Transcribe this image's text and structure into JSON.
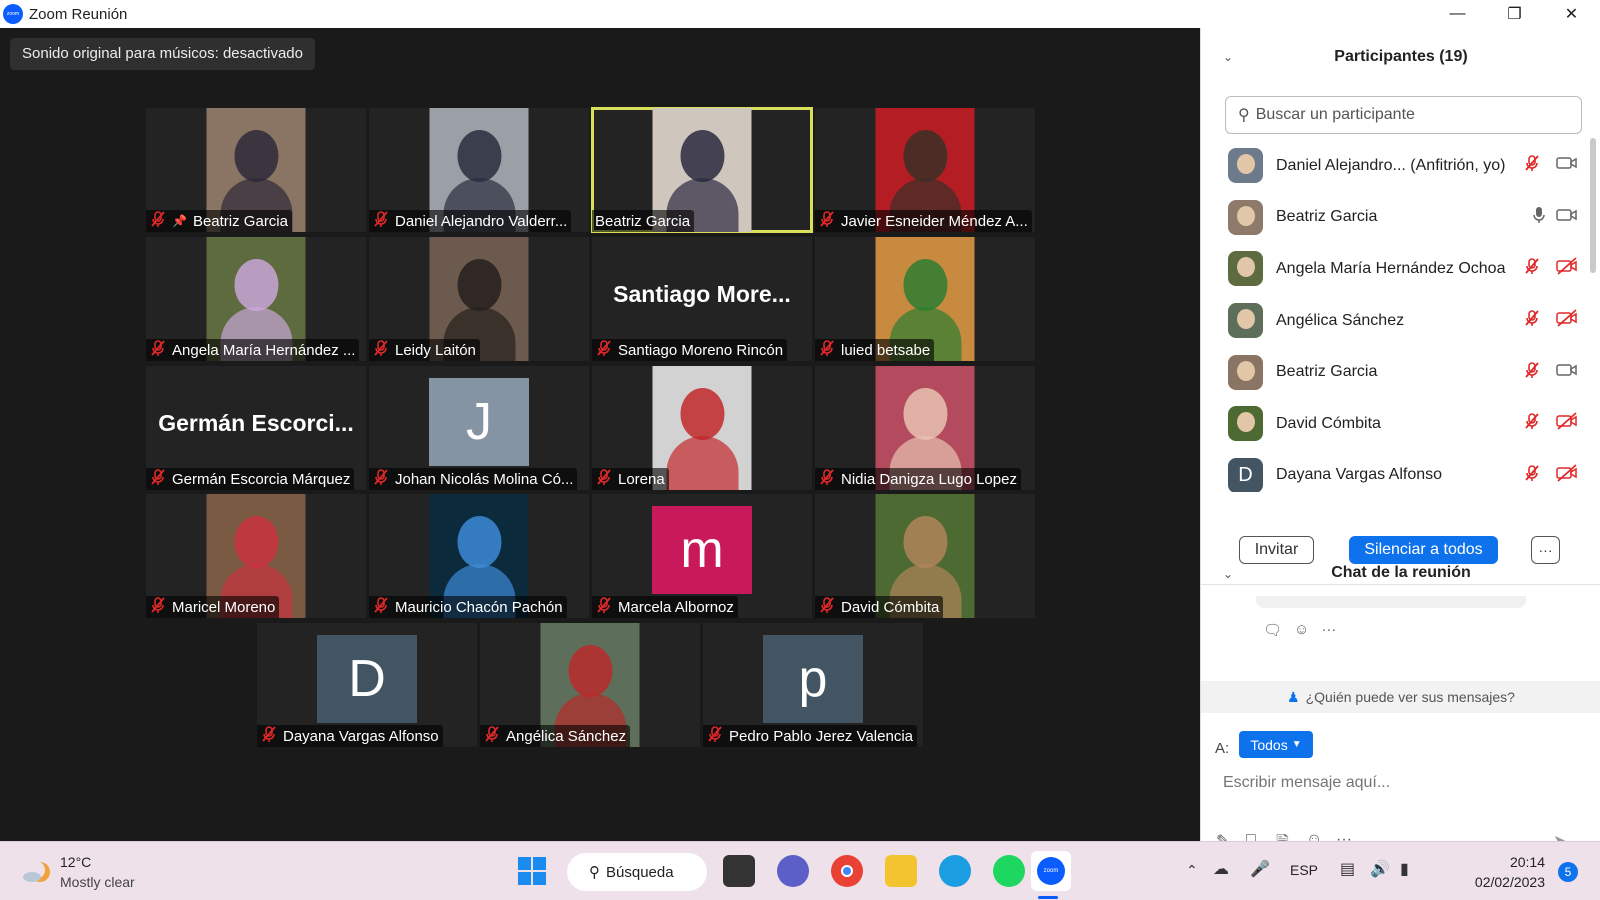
{
  "window": {
    "title": "Zoom Reunión",
    "logo_text": "zoom"
  },
  "banner": {
    "sound": "Sonido original para músicos: desactivado"
  },
  "tiles": [
    {
      "name": "Beatriz Garcia",
      "pinned": true,
      "kind": "photo",
      "bg": "#8a7463",
      "fg": "#2e2a38"
    },
    {
      "name": "Daniel Alejandro Valderr...",
      "kind": "photo",
      "bg": "#9aa0a6",
      "fg": "#2a2e3d"
    },
    {
      "name": "Beatriz Garcia",
      "kind": "photo",
      "active": true,
      "bg": "#cfc6bd",
      "fg": "#2b2a40"
    },
    {
      "name": "Javier Esneider Méndez A...",
      "kind": "photo",
      "bg": "#b51d25",
      "fg": "#3b2f27"
    },
    {
      "name": "Angela María Hernández ...",
      "kind": "photo",
      "bg": "#5e6b3e",
      "fg": "#c9a6d8"
    },
    {
      "name": "Leidy Laitón",
      "kind": "photo",
      "bg": "#6d5a4e",
      "fg": "#26201d"
    },
    {
      "name": "Santiago Moreno Rincón",
      "kind": "text",
      "big": "Santiago  More..."
    },
    {
      "name": "luied betsabe",
      "kind": "photo",
      "bg": "#c78a3f",
      "fg": "#2e7d32"
    },
    {
      "name": "Germán Escorcia Márquez",
      "kind": "text",
      "big": "Germán  Escorci..."
    },
    {
      "name": "Johan Nicolás Molina Có...",
      "kind": "mono",
      "letter": "J",
      "bg": "#8494a2"
    },
    {
      "name": "Lorena",
      "kind": "photo",
      "bg": "#d2d2d2",
      "fg": "#c2282b"
    },
    {
      "name": "Nidia Danigza Lugo Lopez",
      "kind": "photo",
      "bg": "#b34a5d",
      "fg": "#e8c2b2"
    },
    {
      "name": "Maricel Moreno",
      "kind": "photo",
      "bg": "#7a5a42",
      "fg": "#c9323e"
    },
    {
      "name": "Mauricio Chacón Pachón",
      "kind": "photo",
      "bg": "#0b2a3c",
      "fg": "#3c8bd6"
    },
    {
      "name": "Marcela Albornoz",
      "kind": "mono",
      "letter": "m",
      "bg": "#c8195a"
    },
    {
      "name": "David Cómbita",
      "kind": "photo",
      "bg": "#4c6a31",
      "fg": "#b0845a"
    },
    {
      "name": "Dayana Vargas Alfonso",
      "kind": "mono",
      "letter": "D",
      "bg": "#435562"
    },
    {
      "name": "Angélica Sánchez",
      "kind": "photo",
      "bg": "#5d6f5a",
      "fg": "#b82b2b"
    },
    {
      "name": "Pedro Pablo Jerez Valencia",
      "kind": "mono",
      "letter": "p",
      "bg": "#435562"
    }
  ],
  "participants": {
    "title": "Participantes (19)",
    "search_placeholder": "Buscar un participante",
    "items": [
      {
        "name": "Daniel Alejandro...",
        "tag": " (Anfitrión, yo)",
        "mic": "off",
        "cam": "on",
        "av": "#6c7a8c"
      },
      {
        "name": "Beatriz Garcia",
        "tag": "",
        "mic": "on",
        "cam": "on",
        "av": "#8e7a6a"
      },
      {
        "name": "Angela María Hernández Ochoa",
        "tag": "",
        "mic": "off",
        "cam": "off",
        "av": "#5e6b3e"
      },
      {
        "name": "Angélica Sánchez",
        "tag": "",
        "mic": "off",
        "cam": "off",
        "av": "#5d6f5a"
      },
      {
        "name": "Beatriz Garcia",
        "tag": "",
        "mic": "off",
        "cam": "on",
        "av": "#8a7463"
      },
      {
        "name": "David Cómbita",
        "tag": "",
        "mic": "off",
        "cam": "off",
        "av": "#4c6a31"
      },
      {
        "name": "Dayana Vargas Alfonso",
        "tag": "",
        "mic": "off",
        "cam": "off",
        "av": "#435562",
        "letter": "D"
      }
    ],
    "invite": "Invitar",
    "mute_all": "Silenciar a todos",
    "more": "···"
  },
  "chat": {
    "title": "Chat de la reunión",
    "privacy": "¿Quién puede ver sus mensajes?",
    "to_label": "A:",
    "to_value": "Todos",
    "input_placeholder": "Escribir mensaje aquí..."
  },
  "taskbar": {
    "temp": "12°C",
    "weather": "Mostly clear",
    "search": "Búsqueda",
    "lang": "ESP",
    "time": "20:14",
    "date": "02/02/2023",
    "notifications": "5"
  },
  "colors": {
    "accent": "#0e72ed",
    "muted_red": "#e02828",
    "active_border": "#d8e05a"
  }
}
